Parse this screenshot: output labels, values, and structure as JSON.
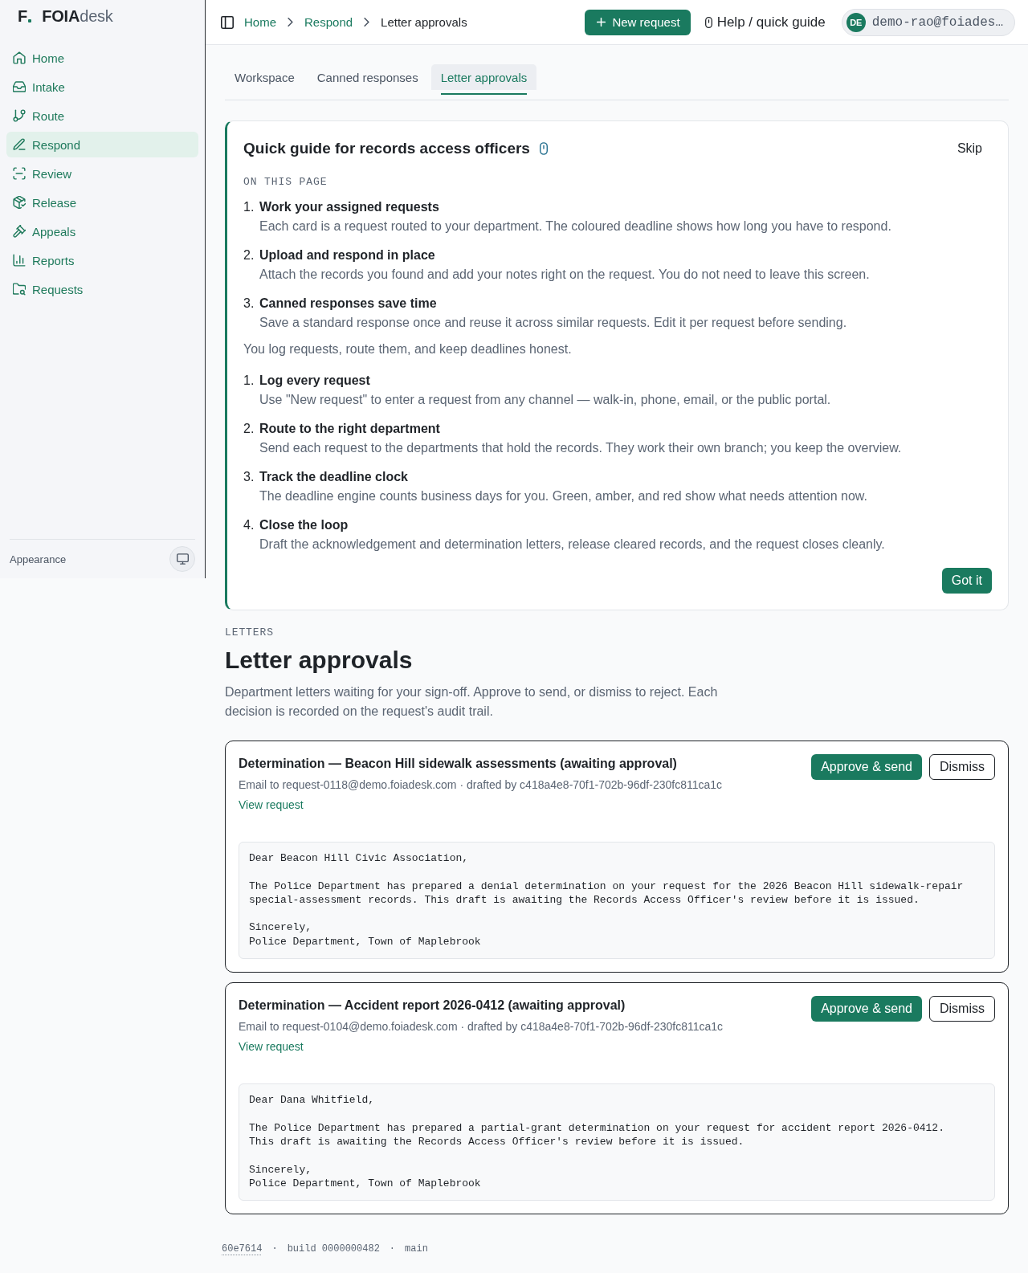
{
  "sidebar": {
    "logo": {
      "mark": "F",
      "wordmark": "**FOIA**desk"
    },
    "items": [
      {
        "label": "Home",
        "selected": false
      },
      {
        "label": "Intake",
        "selected": false
      },
      {
        "label": "Route",
        "selected": false
      },
      {
        "label": "Respond",
        "selected": true
      },
      {
        "label": "Review",
        "selected": false
      },
      {
        "label": "Release",
        "selected": false
      },
      {
        "label": "Appeals",
        "selected": false
      },
      {
        "label": "Reports",
        "selected": false
      },
      {
        "label": "Requests",
        "selected": false
      }
    ],
    "appearance": {
      "label": "Appearance"
    }
  },
  "header": {
    "breadcrumbs": [
      {
        "label": "Home",
        "kind": "link"
      },
      {
        "label": "Respond",
        "kind": "link"
      },
      {
        "label": "Letter approvals",
        "kind": "current"
      }
    ],
    "new_request": "New request",
    "help": "Help / quick guide",
    "user": {
      "initials": "DE",
      "email": "demo-rao@foiades…"
    }
  },
  "tabs": [
    {
      "label": "Workspace",
      "selected": false
    },
    {
      "label": "Canned responses",
      "selected": false
    },
    {
      "label": "Letter approvals",
      "selected": true
    }
  ],
  "guide": {
    "title": "Quick guide for records access officers",
    "skip": "Skip",
    "section_label": "ON THIS PAGE",
    "page_steps": [
      {
        "number": "1.",
        "title": "Work your assigned requests",
        "text": "Each card is a request routed to your department. The coloured deadline shows how long you have to respond."
      },
      {
        "number": "2.",
        "title": "Upload and respond in place",
        "text": "Attach the records you found and add your notes right on the request. You do not need to leave this screen."
      },
      {
        "number": "3.",
        "title": "Canned responses save time",
        "text": "Save a standard response once and reuse it across similar requests. Edit it per request before sending."
      }
    ],
    "intro": "You log requests, route them, and keep deadlines honest.",
    "role_steps": [
      {
        "number": "1.",
        "title": "Log every request",
        "text": "Use \"New request\" to enter a request from any channel — walk-in, phone, email, or the public portal."
      },
      {
        "number": "2.",
        "title": "Route to the right department",
        "text": "Send each request to the departments that hold the records. They work their own branch; you keep the overview."
      },
      {
        "number": "3.",
        "title": "Track the deadline clock",
        "text": "The deadline engine counts business days for you. Green, amber, and red show what needs attention now."
      },
      {
        "number": "4.",
        "title": "Close the loop",
        "text": "Draft the acknowledgement and determination letters, release cleared records, and the request closes cleanly."
      }
    ],
    "dismiss": "Got it"
  },
  "letters": {
    "eyebrow": "LETTERS",
    "title": "Letter approvals",
    "description": "Department letters waiting for your sign-off. Approve to send, or dismiss to reject. Each decision is recorded on the request's audit trail.",
    "cards": [
      {
        "title": "Determination — Beacon Hill sidewalk assessments (awaiting approval)",
        "meta": "Email to request-0118@demo.foiadesk.com · drafted by c418a4e8-70f1-702b-96df-230fc811ca1c",
        "link": "View request",
        "approve": "Approve & send",
        "dismiss": "Dismiss",
        "body": "Dear Beacon Hill Civic Association,\n\nThe Police Department has prepared a denial determination on your request for the 2026 Beacon Hill sidewalk-repair\nspecial-assessment records. This draft is awaiting the Records Access Officer's review before it is issued.\n\nSincerely,\nPolice Department, Town of Maplebrook"
      },
      {
        "title": "Determination — Accident report 2026-0412 (awaiting approval)",
        "meta": "Email to request-0104@demo.foiadesk.com · drafted by c418a4e8-70f1-702b-96df-230fc811ca1c",
        "link": "View request",
        "approve": "Approve & send",
        "dismiss": "Dismiss",
        "body": "Dear Dana Whitfield,\n\nThe Police Department has prepared a partial-grant determination on your request for accident report 2026-0412.\nThis draft is awaiting the Records Access Officer's review before it is issued.\n\nSincerely,\nPolice Department, Town of Maplebrook"
      }
    ]
  },
  "footer": [
    {
      "text": "60e7614",
      "kind": "commit"
    },
    {
      "text": "·",
      "kind": "separator"
    },
    {
      "text": "build 0000000482",
      "kind": "text"
    },
    {
      "text": "·",
      "kind": "separator"
    },
    {
      "text": "main",
      "kind": "text"
    }
  ]
}
